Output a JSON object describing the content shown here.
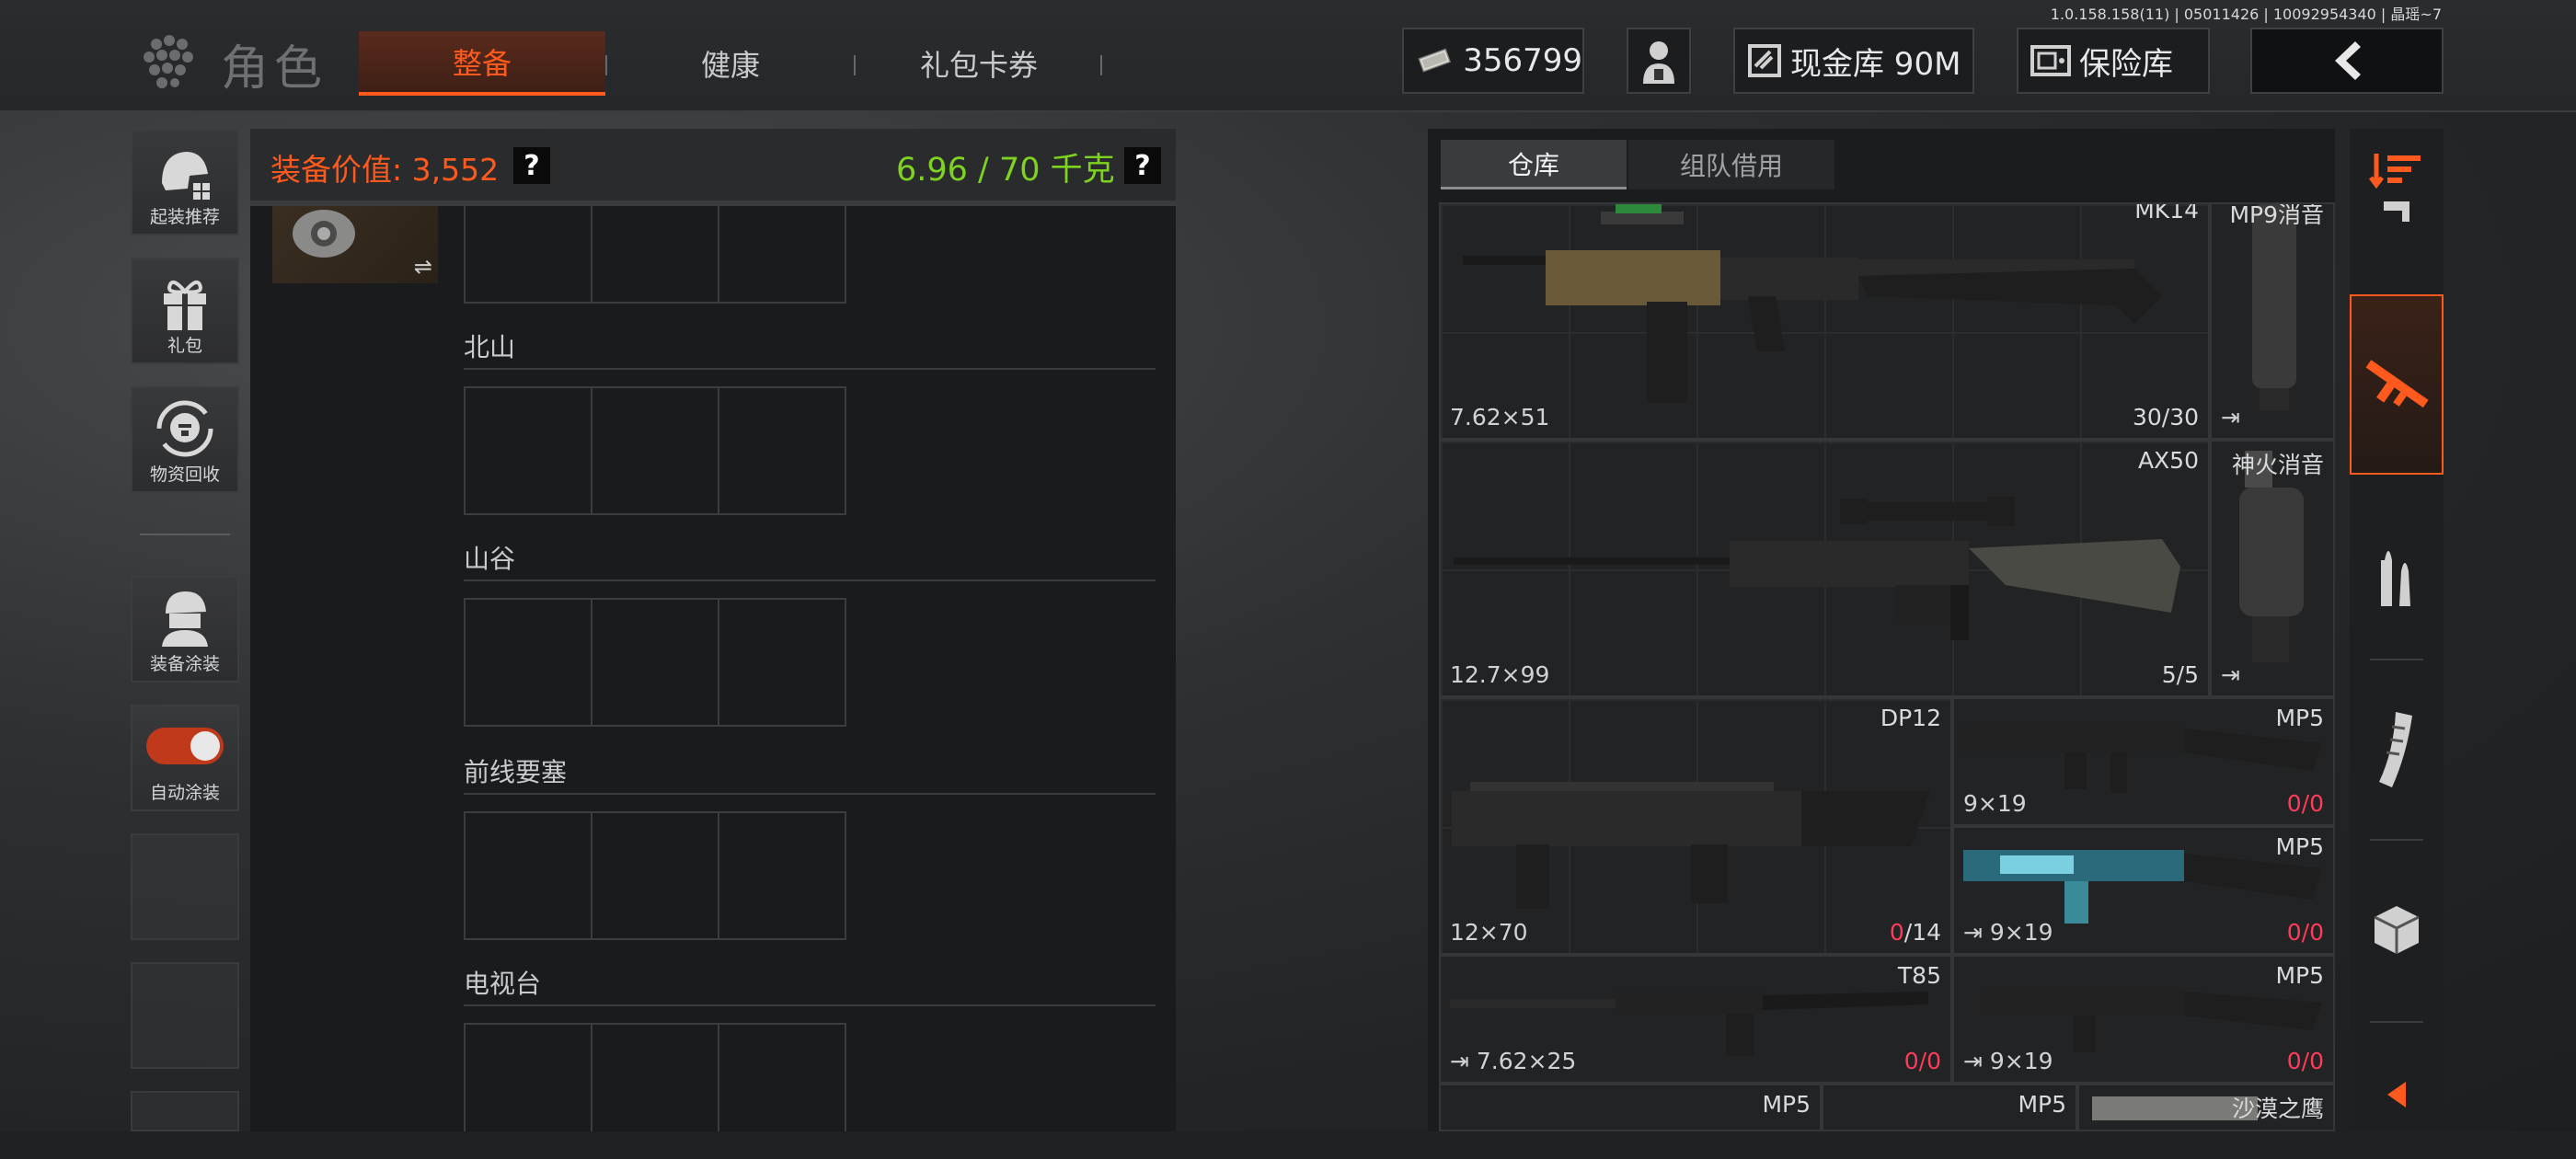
{
  "version": "1.0.158.158(11) | 05011426 | 10092954340 | 晶瑶~7",
  "header": {
    "title": "角色",
    "tabs": [
      {
        "label": "整备",
        "active": true
      },
      {
        "label": "健康",
        "active": false
      },
      {
        "label": "礼包卡券",
        "active": false
      }
    ],
    "currency": "356799",
    "cash_vault": "现金库 90M",
    "safe_box": "保险库"
  },
  "sidebar": {
    "items": [
      {
        "label": "起装推荐",
        "icon": "helmet-icon"
      },
      {
        "label": "礼包",
        "icon": "gift-icon"
      },
      {
        "label": "物资回收",
        "icon": "recycle-icon"
      },
      {
        "label": "装备涂装",
        "icon": "soldier-icon"
      },
      {
        "label": "自动涂装",
        "icon": "toggle-icon",
        "toggle_on": true
      }
    ]
  },
  "loadout": {
    "value_label": "装备价值: 3,552",
    "weight_label": "6.96 / 70 千克",
    "help": "?",
    "swap": "⇌",
    "sections": [
      "北山",
      "山谷",
      "前线要塞",
      "电视台"
    ]
  },
  "storage": {
    "tabs": [
      "仓库",
      "组队借用"
    ],
    "weapons": [
      {
        "name": "MK14",
        "caliber": "7.62×51",
        "ammo_current": "30",
        "ammo_max": "30",
        "empty": false
      },
      {
        "name": "MP9消音",
        "caliber": "",
        "ammo_current": "",
        "ammo_max": "",
        "attach": "⇥"
      },
      {
        "name": "AX50",
        "caliber": "12.7×99",
        "ammo_current": "5",
        "ammo_max": "5",
        "empty": false
      },
      {
        "name": "神火消音",
        "caliber": "",
        "ammo_current": "",
        "ammo_max": "",
        "attach": "⇥"
      },
      {
        "name": "DP12",
        "caliber": "12×70",
        "ammo_current": "0",
        "ammo_max": "14",
        "empty": true
      },
      {
        "name": "MP5",
        "caliber": "9×19",
        "ammo_current": "0",
        "ammo_max": "0",
        "empty": true
      },
      {
        "name": "MP5",
        "caliber": "9×19",
        "ammo_current": "0",
        "ammo_max": "0",
        "empty": true,
        "attach": "⇥"
      },
      {
        "name": "T85",
        "caliber": "7.62×25",
        "ammo_current": "0",
        "ammo_max": "0",
        "empty": true,
        "attach": "⇥"
      },
      {
        "name": "MP5",
        "caliber": "9×19",
        "ammo_current": "0",
        "ammo_max": "0",
        "empty": true,
        "attach": "⇥"
      },
      {
        "name": "MP5",
        "caliber": "",
        "ammo_current": "",
        "ammo_max": ""
      },
      {
        "name": "MP5",
        "caliber": "",
        "ammo_current": "",
        "ammo_max": ""
      },
      {
        "name": "沙漠之鹰",
        "caliber": "",
        "ammo_current": "",
        "ammo_max": ""
      }
    ]
  },
  "categories": [
    "sort-icon",
    "backpack-icon",
    "rifle-icon",
    "ammo-icon",
    "magazine-icon",
    "crate-icon",
    "collapse-icon"
  ],
  "colors": {
    "accent": "#ff5a1e",
    "weight": "#7ed321",
    "empty_ammo": "#ff3a5a"
  }
}
